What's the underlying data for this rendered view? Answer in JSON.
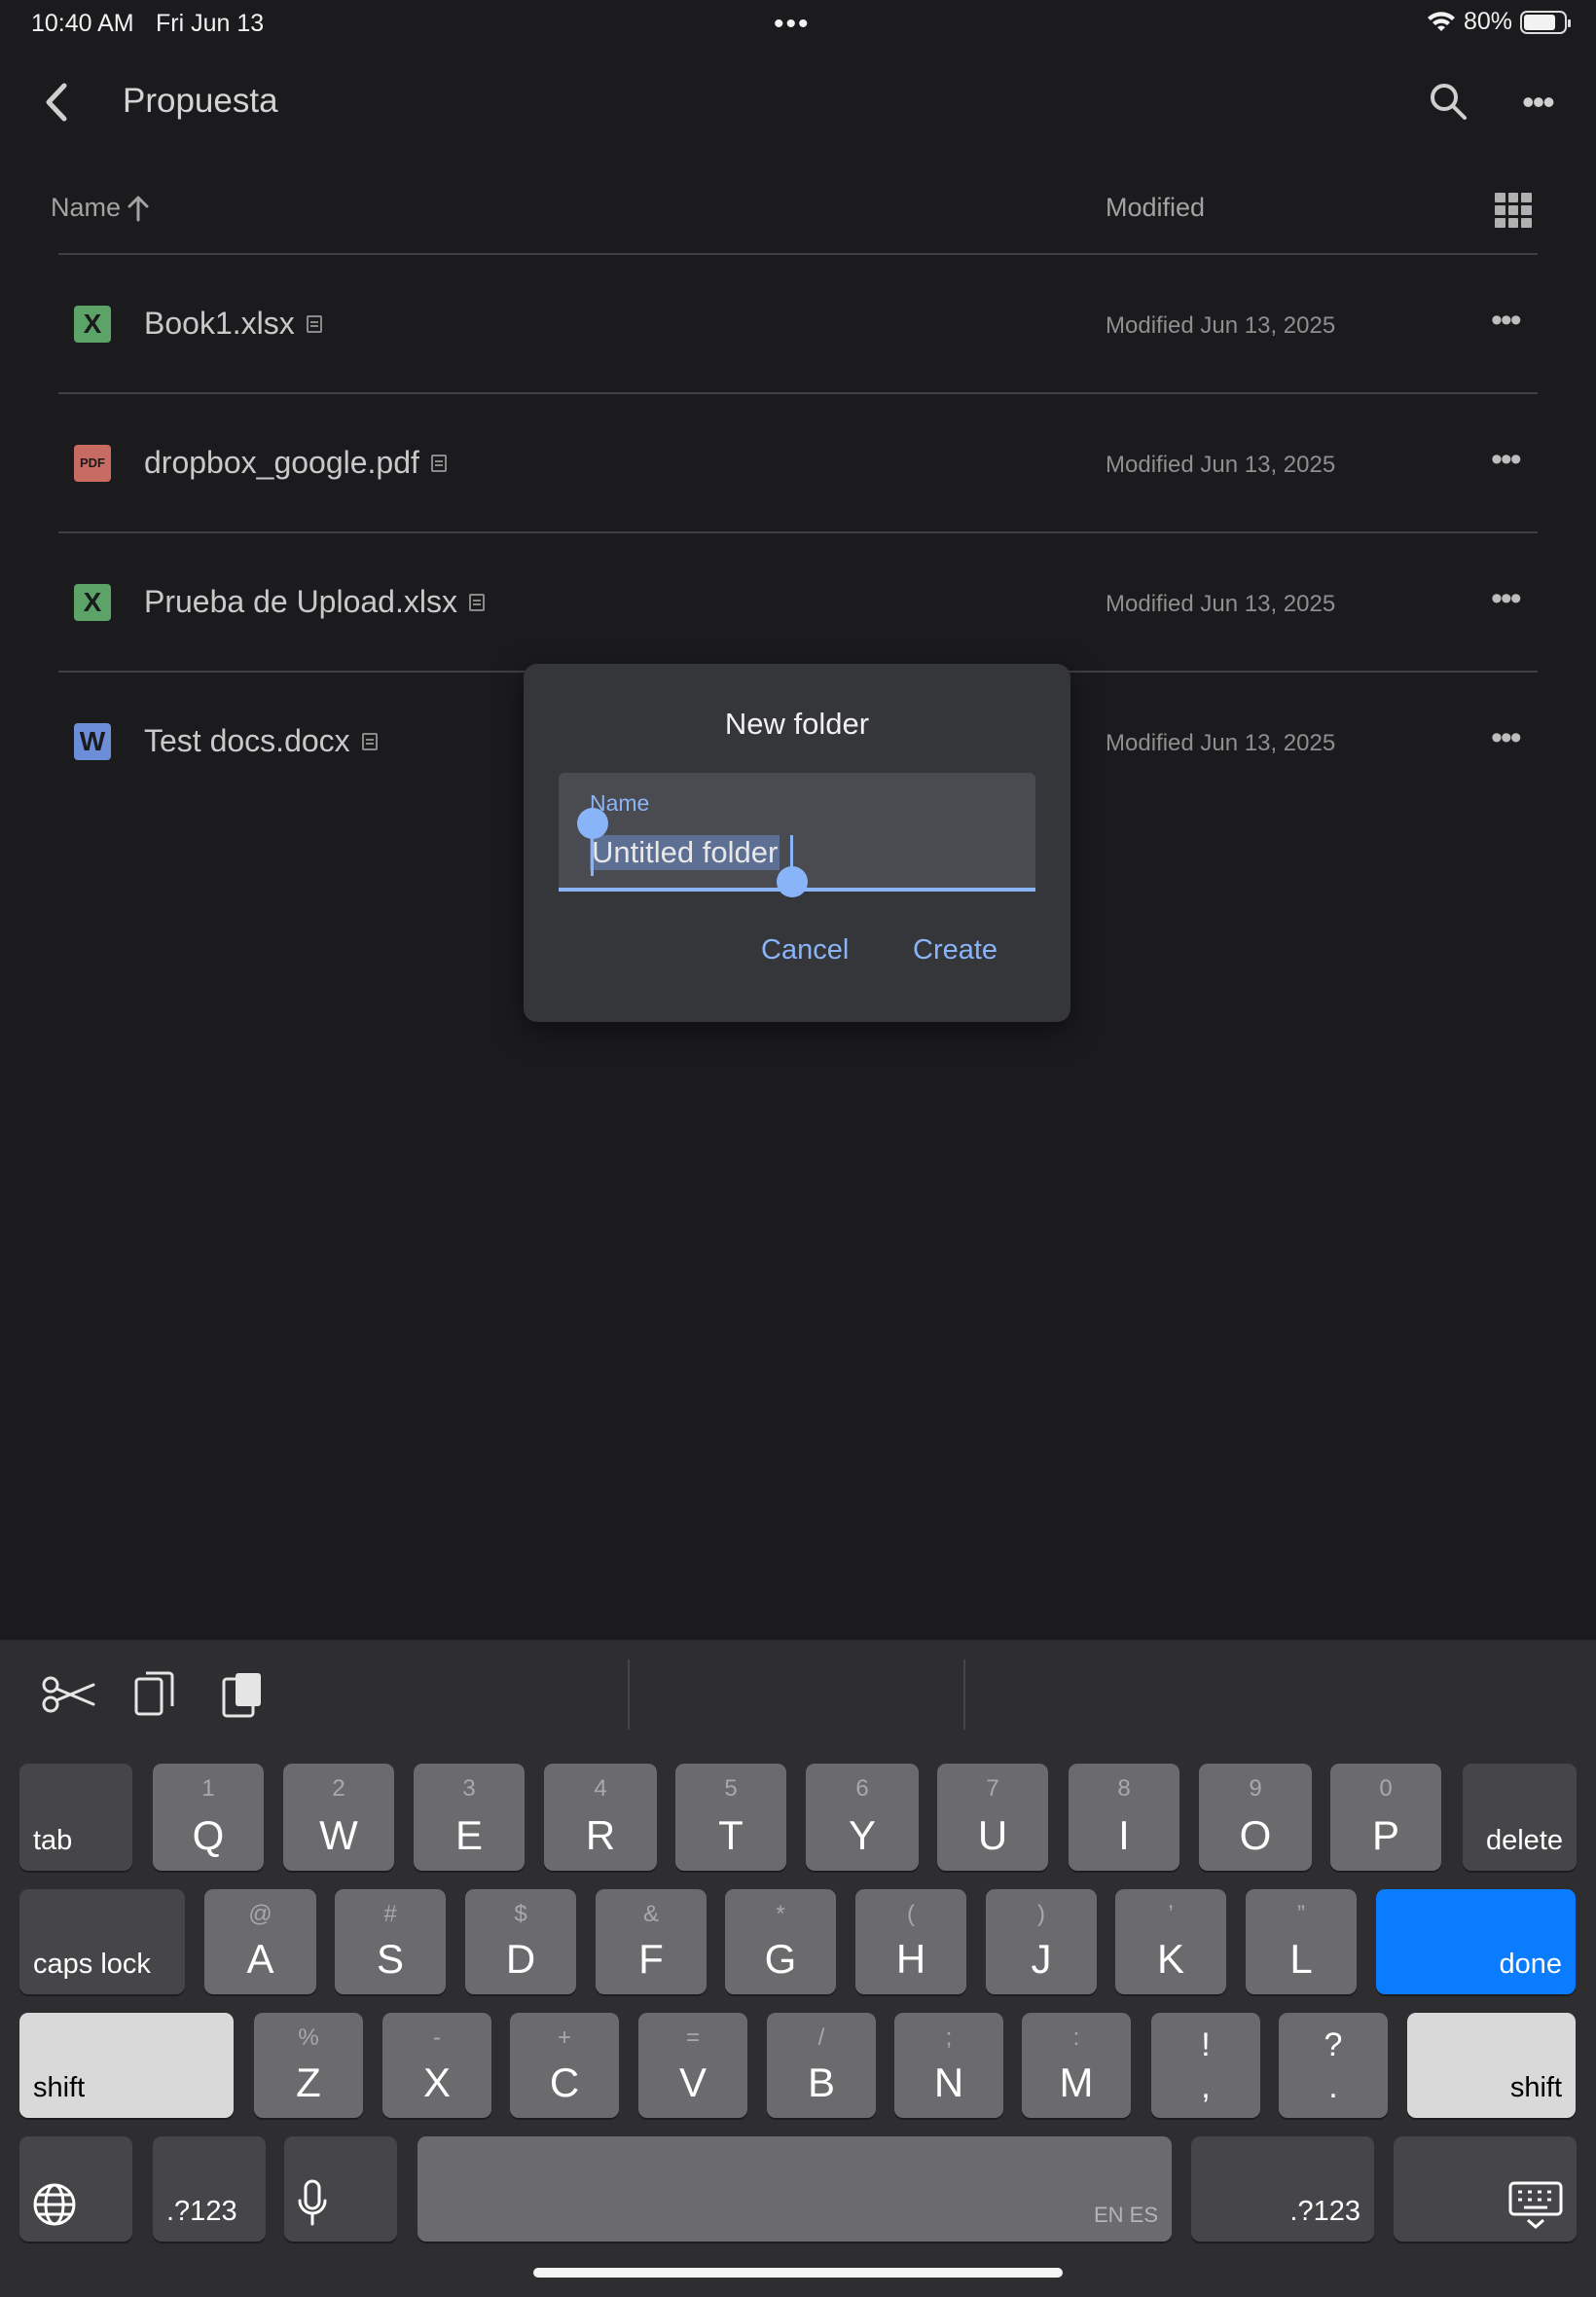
{
  "status": {
    "time": "10:40 AM",
    "date": "Fri Jun 13",
    "battery": "80%",
    "battery_level": 0.8
  },
  "header": {
    "title": "Propuesta"
  },
  "columns": {
    "name": "Name",
    "modified": "Modified"
  },
  "files": [
    {
      "name": "Book1.xlsx",
      "icon": "excel-icon",
      "badge": "X",
      "badge_color": "#5ba366",
      "modified": "Modified Jun 13, 2025"
    },
    {
      "name": "dropbox_google.pdf",
      "icon": "pdf-icon",
      "badge": "PDF",
      "badge_color": "#c86b62",
      "modified": "Modified Jun 13, 2025"
    },
    {
      "name": "Prueba de Upload.xlsx",
      "icon": "excel-icon",
      "badge": "X",
      "badge_color": "#5ba366",
      "modified": "Modified Jun 13, 2025"
    },
    {
      "name": "Test docs.docx",
      "icon": "word-icon",
      "badge": "W",
      "badge_color": "#6c8ed8",
      "modified": "Modified Jun 13, 2025"
    }
  ],
  "dialog": {
    "title": "New folder",
    "field_label": "Name",
    "field_value": "Untitled folder",
    "cancel": "Cancel",
    "create": "Create"
  },
  "keyboard": {
    "row1": [
      {
        "sub": "1",
        "main": "Q"
      },
      {
        "sub": "2",
        "main": "W"
      },
      {
        "sub": "3",
        "main": "E"
      },
      {
        "sub": "4",
        "main": "R"
      },
      {
        "sub": "5",
        "main": "T"
      },
      {
        "sub": "6",
        "main": "Y"
      },
      {
        "sub": "7",
        "main": "U"
      },
      {
        "sub": "8",
        "main": "I"
      },
      {
        "sub": "9",
        "main": "O"
      },
      {
        "sub": "0",
        "main": "P"
      }
    ],
    "row2": [
      {
        "sub": "@",
        "main": "A"
      },
      {
        "sub": "#",
        "main": "S"
      },
      {
        "sub": "$",
        "main": "D"
      },
      {
        "sub": "&",
        "main": "F"
      },
      {
        "sub": "*",
        "main": "G"
      },
      {
        "sub": "(",
        "main": "H"
      },
      {
        "sub": ")",
        "main": "J"
      },
      {
        "sub": "’",
        "main": "K"
      },
      {
        "sub": "”",
        "main": "L"
      }
    ],
    "row3": [
      {
        "sub": "%",
        "main": "Z"
      },
      {
        "sub": "-",
        "main": "X"
      },
      {
        "sub": "+",
        "main": "C"
      },
      {
        "sub": "=",
        "main": "V"
      },
      {
        "sub": "/",
        "main": "B"
      },
      {
        "sub": ";",
        "main": "N"
      },
      {
        "sub": ":",
        "main": "M"
      },
      {
        "sub": "!",
        "main": ","
      },
      {
        "sub": "?",
        "main": "."
      }
    ],
    "tab": "tab",
    "delete": "delete",
    "caps_lock": "caps lock",
    "done": "done",
    "shift": "shift",
    "numbers": ".?123",
    "space_hint": "EN ES"
  }
}
